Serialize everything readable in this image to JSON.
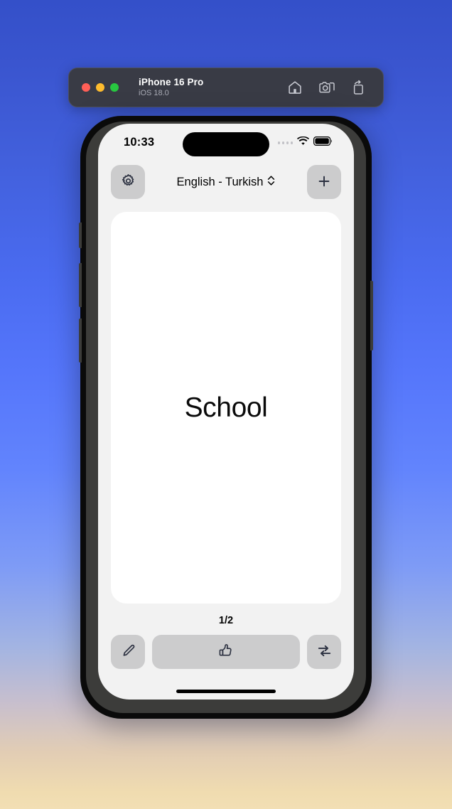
{
  "simulator": {
    "device_name": "iPhone 16 Pro",
    "os_version": "iOS 18.0",
    "traffic_lights": {
      "close_color": "#ff5f57",
      "minimize_color": "#febc2e",
      "zoom_color": "#28c840"
    },
    "toolbar_icons": [
      "home-icon",
      "screenshot-icon",
      "screen-rotate-icon"
    ],
    "titlebar_bg": "#393b45"
  },
  "status_bar": {
    "time": "10:33",
    "cellular": "cellular-signal-icon",
    "wifi": "wifi-icon",
    "battery": "battery-full-icon"
  },
  "app": {
    "settings_button": "gear-icon",
    "language_pair": "English - Turkish",
    "language_picker_icon": "chevron-up-down-icon",
    "add_button_label": "+",
    "card": {
      "word": "School"
    },
    "counter": "1/2",
    "edit_button": "pencil-icon",
    "know_button": "thumbs-up-icon",
    "shuffle_button": "repeat-swap-icon",
    "colors": {
      "screen_bg": "#f2f2f2",
      "card_bg": "#ffffff",
      "button_bg": "#cccccd",
      "text": "#000000"
    }
  },
  "background": {
    "gradient_top": "#3450c9",
    "gradient_mid": "#6284fd",
    "gradient_bottom": "#f2dfb4"
  }
}
